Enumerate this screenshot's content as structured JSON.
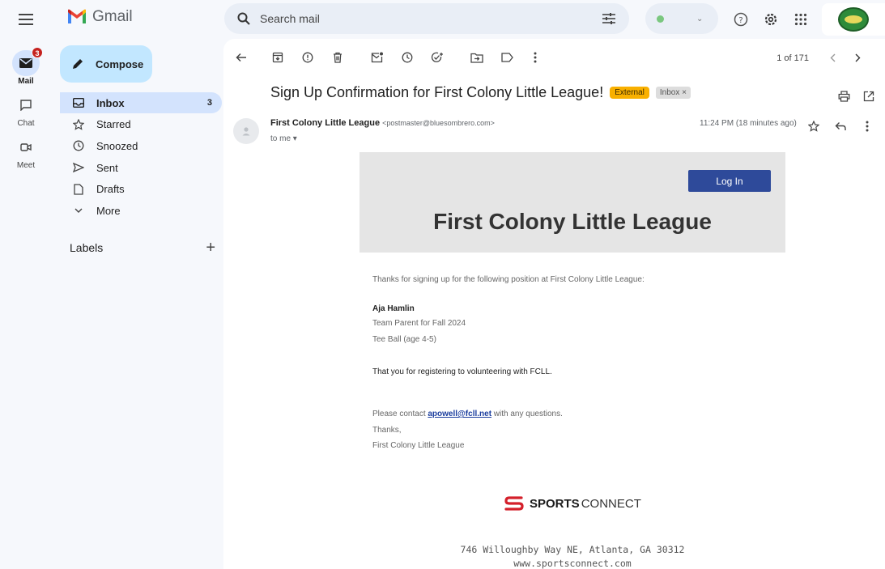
{
  "app": {
    "name": "Gmail"
  },
  "search": {
    "placeholder": "Search mail"
  },
  "rail": [
    {
      "label": "Mail",
      "badge": "3"
    },
    {
      "label": "Chat"
    },
    {
      "label": "Meet"
    }
  ],
  "compose": {
    "label": "Compose"
  },
  "nav": [
    {
      "label": "Inbox",
      "count": "3"
    },
    {
      "label": "Starred"
    },
    {
      "label": "Snoozed"
    },
    {
      "label": "Sent"
    },
    {
      "label": "Drafts"
    },
    {
      "label": "More"
    }
  ],
  "labels": {
    "title": "Labels",
    "add": "+"
  },
  "toolbar": {
    "pager": "1 of 171"
  },
  "message": {
    "subject": "Sign Up Confirmation for First Colony Little League!",
    "chip_external": "External",
    "chip_inbox": "Inbox ×",
    "sender_name": "First Colony Little League",
    "sender_email": "<postmaster@bluesombrero.com>",
    "to": "to me ▾",
    "time": "11:24 PM (18 minutes ago)"
  },
  "email": {
    "login_label": "Log In",
    "league_title": "First Colony Little League",
    "intro": "Thanks for signing up for the following position at First Colony Little League:",
    "person_name": "Aja Hamlin",
    "role": "Team Parent for Fall 2024",
    "division": "Tee Ball (age 4-5)",
    "thanks_line": "That you for registering to volunteering with FCLL.",
    "contact_prefix": "Please contact ",
    "contact_email": "apowell@fcll.net",
    "contact_suffix": " with any questions.",
    "signoff": "Thanks,",
    "signature": "First Colony Little League",
    "brand_bold": "SPORTS",
    "brand_light": " CONNECT",
    "address": "746 Willoughby Way NE, Atlanta, GA 30312",
    "website": "www.sportsconnect.com"
  },
  "colors": {
    "accent": "#c2e7ff",
    "active": "#d3e3fd",
    "external_chip": "#f9b000",
    "login_button": "#2e4a9a",
    "brand_red": "#d4202b"
  }
}
